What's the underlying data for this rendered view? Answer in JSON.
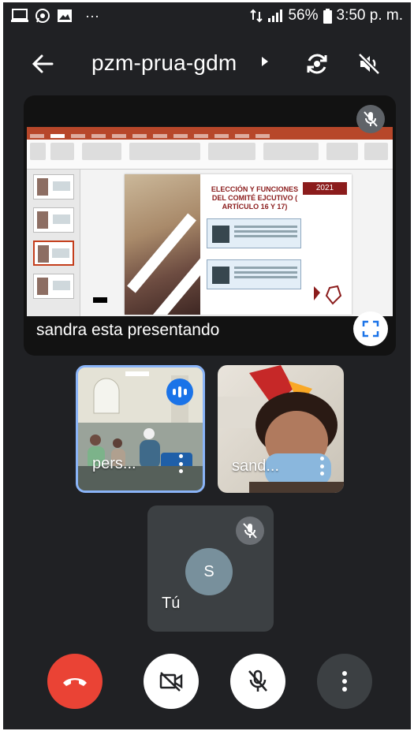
{
  "status_bar": {
    "battery": "56%",
    "time": "3:50 p. m.",
    "notif_icons": [
      "monitor-icon",
      "whatsapp-icon",
      "image-icon"
    ],
    "more": "···"
  },
  "meeting": {
    "code": "pzm-prua-gdm"
  },
  "presentation": {
    "presenting_text": "sandra esta presentando",
    "slide": {
      "heading": "ELECCIÓN Y FUNCIONES DEL COMITÉ EJCUTIVO ( ARTÍCULO 16 Y 17)",
      "year": "2021"
    }
  },
  "participants": [
    {
      "name": "pers...",
      "speaking": true
    },
    {
      "name": "sand...",
      "speaking": false
    }
  ],
  "self_tile": {
    "name": "Tú",
    "avatar_letter": "S",
    "muted": true
  },
  "controls": {
    "end_call_color": "#ea4335",
    "accent_blue": "#1a73e8"
  }
}
